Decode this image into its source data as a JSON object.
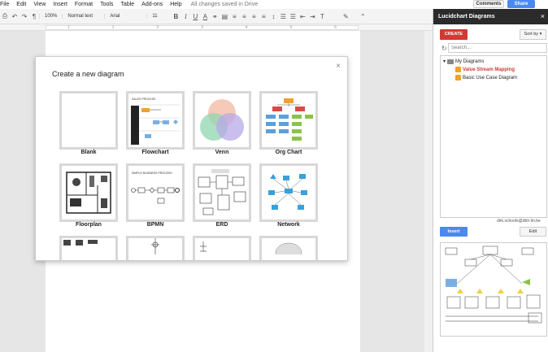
{
  "menu": {
    "items": [
      "File",
      "Edit",
      "View",
      "Insert",
      "Format",
      "Tools",
      "Table",
      "Add-ons",
      "Help"
    ],
    "saved_status": "All changes saved in Drive"
  },
  "header": {
    "comments_label": "Comments",
    "share_label": "Share",
    "share_color": "#4a89f0"
  },
  "toolbar": {
    "zoom": "100%",
    "style": "Normal text",
    "font": "Arial",
    "size": "11",
    "bold": "B",
    "italic": "I",
    "underline": "U",
    "text_color": "A"
  },
  "ruler": {
    "ticks": [
      "1",
      "1",
      "2",
      "3",
      "4",
      "5",
      "6"
    ]
  },
  "modal": {
    "title": "Create a new diagram",
    "close": "×",
    "tiles": [
      {
        "label": "Blank"
      },
      {
        "label": "Flowchart",
        "caption": "SALES PROCESS"
      },
      {
        "label": "Venn"
      },
      {
        "label": "Org Chart"
      },
      {
        "label": "Floorplan"
      },
      {
        "label": "BPMN",
        "caption": "SIMPLE BUSINESS PROCESS"
      },
      {
        "label": "ERD"
      },
      {
        "label": "Network"
      }
    ]
  },
  "sidebar": {
    "title": "Lucidchart Diagrams",
    "close": "×",
    "create_label": "CREATE",
    "create_color": "#d13a32",
    "sort_label": "Sort by",
    "search_placeholder": "Search...",
    "tree": {
      "folder": "My Diagrams",
      "items": [
        {
          "label": "Value Stream Mapping",
          "active": true
        },
        {
          "label": "Basic Use Case Diagram",
          "active": false
        }
      ]
    },
    "user": "dirk.schoofs@dbh-lin.be",
    "insert_label": "Insert",
    "edit_label": "Edit"
  }
}
